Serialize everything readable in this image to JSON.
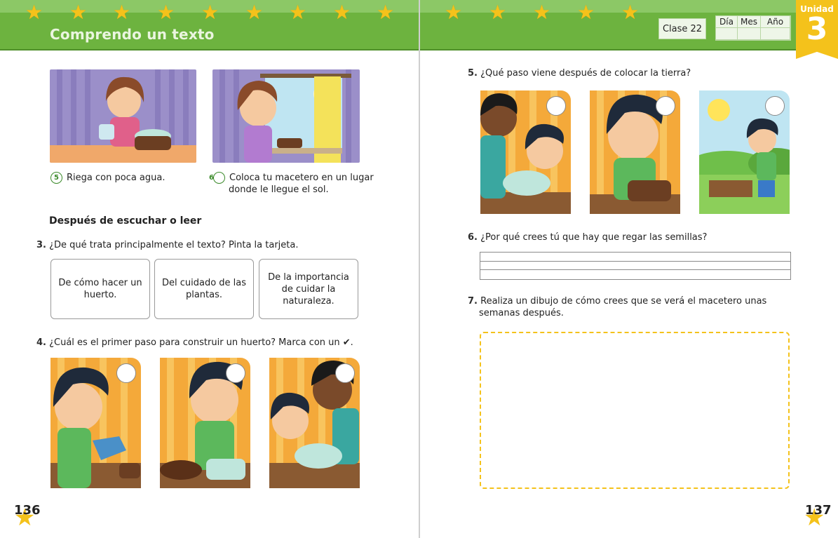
{
  "left_page": {
    "header_title": "Comprendo un texto",
    "page_number": "136",
    "steps": [
      {
        "num": "5",
        "text": "Riega con poca agua."
      },
      {
        "num": "6",
        "text": "Coloca  tu macetero en un lugar donde le llegue el sol."
      }
    ],
    "section_title": "Después de escuchar o leer",
    "q3": {
      "num": "3.",
      "text": "¿De qué trata principalmente el texto? Pinta la tarjeta."
    },
    "cards": [
      "De cómo hacer un huerto.",
      "Del cuidado de las plantas.",
      "De la importancia de cuidar la naturaleza."
    ],
    "q4": {
      "num": "4.",
      "text": "¿Cuál es el primer paso para construir un huerto? Marca con un ✔."
    }
  },
  "right_page": {
    "clase": "Clase 22",
    "date_labels": [
      "Día",
      "Mes",
      "Año"
    ],
    "unidad_label": "Unidad",
    "unidad_number": "3",
    "page_number": "137",
    "q5": {
      "num": "5.",
      "text": "¿Qué paso viene después de colocar la tierra?"
    },
    "q6": {
      "num": "6.",
      "text": "¿Por qué crees tú que hay que regar las semillas?"
    },
    "q7": {
      "num": "7.",
      "text": "Realiza un dibujo de cómo crees que se verá el macetero unas semanas después."
    }
  },
  "colors": {
    "header_green": "#6db33f",
    "star_yellow": "#f4c21b",
    "accent_green": "#3b8a2a"
  }
}
